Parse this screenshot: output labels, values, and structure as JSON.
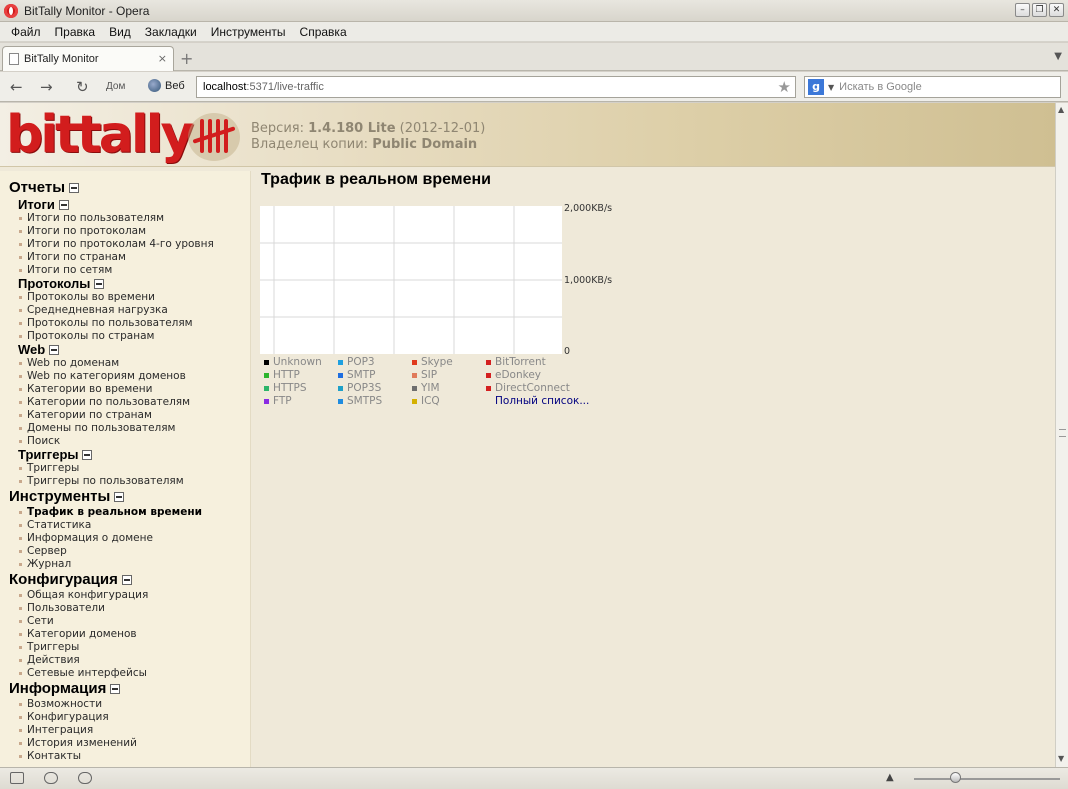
{
  "window": {
    "title": "BitTally Monitor - Opera"
  },
  "menu": [
    "Файл",
    "Правка",
    "Вид",
    "Закладки",
    "Инструменты",
    "Справка"
  ],
  "tab": {
    "title": "BitTally Monitor"
  },
  "toolbar": {
    "dial_label": "Дом",
    "web_label": "Веб"
  },
  "address": {
    "host": "localhost",
    "path": ":5371/live-traffic"
  },
  "search": {
    "placeholder": "Искать в Google",
    "engine_letter": "g"
  },
  "header": {
    "logo": "bittally",
    "version_label": "Версия:",
    "version_value": "1.4.180 Lite",
    "version_date": "(2012-12-01)",
    "owner_label": "Владелец копии:",
    "owner_value": "Public Domain"
  },
  "sidebar": {
    "reports": "Отчеты",
    "totals": "Итоги",
    "totals_links": [
      "Итоги по пользователям",
      "Итоги по протоколам",
      "Итоги по протоколам 4-го уровня",
      "Итоги по странам",
      "Итоги по сетям"
    ],
    "protocols": "Протоколы",
    "protocols_links": [
      "Протоколы во времени",
      "Среднедневная нагрузка",
      "Протоколы по пользователям",
      "Протоколы по странам"
    ],
    "web": "Web",
    "web_links": [
      "Web по доменам",
      "Web по категориям доменов",
      "Категории во времени",
      "Категории по пользователям",
      "Категории по странам",
      "Домены по пользователям",
      "Поиск"
    ],
    "triggers": "Триггеры",
    "triggers_links": [
      "Триггеры",
      "Триггеры по пользователям"
    ],
    "tools": "Инструменты",
    "tools_links": [
      "Трафик в реальном времени",
      "Статистика",
      "Информация о домене",
      "Сервер",
      "Журнал"
    ],
    "config": "Конфигурация",
    "config_links": [
      "Общая конфигурация",
      "Пользователи",
      "Сети",
      "Категории доменов",
      "Триггеры",
      "Действия",
      "Сетевые интерфейсы"
    ],
    "info": "Информация",
    "info_links": [
      "Возможности",
      "Конфигурация",
      "Интеграция",
      "История изменений",
      "Контакты"
    ]
  },
  "main": {
    "title": "Трафик в реальном времени",
    "full_list": "Полный список..."
  },
  "chart_data": {
    "type": "line",
    "title": "",
    "ylim": [
      0,
      2000
    ],
    "y_ticks": [
      "2,000KB/s",
      "1,000KB/s",
      "0"
    ],
    "grid": true,
    "series": [],
    "legend": [
      {
        "name": "Unknown",
        "color": "#000000"
      },
      {
        "name": "HTTP",
        "color": "#2db52d"
      },
      {
        "name": "HTTPS",
        "color": "#2db56a"
      },
      {
        "name": "FTP",
        "color": "#8a2be2"
      },
      {
        "name": "POP3",
        "color": "#1ea0e0"
      },
      {
        "name": "SMTP",
        "color": "#1e6ee0"
      },
      {
        "name": "POP3S",
        "color": "#1ea0c8"
      },
      {
        "name": "SMTPS",
        "color": "#1e8ce0"
      },
      {
        "name": "Skype",
        "color": "#e03a1e"
      },
      {
        "name": "SIP",
        "color": "#e07a5a"
      },
      {
        "name": "YIM",
        "color": "#6e6e6e"
      },
      {
        "name": "ICQ",
        "color": "#d4b000"
      },
      {
        "name": "BitTorrent",
        "color": "#d42020"
      },
      {
        "name": "eDonkey",
        "color": "#d42020"
      },
      {
        "name": "DirectConnect",
        "color": "#d42020"
      }
    ]
  }
}
